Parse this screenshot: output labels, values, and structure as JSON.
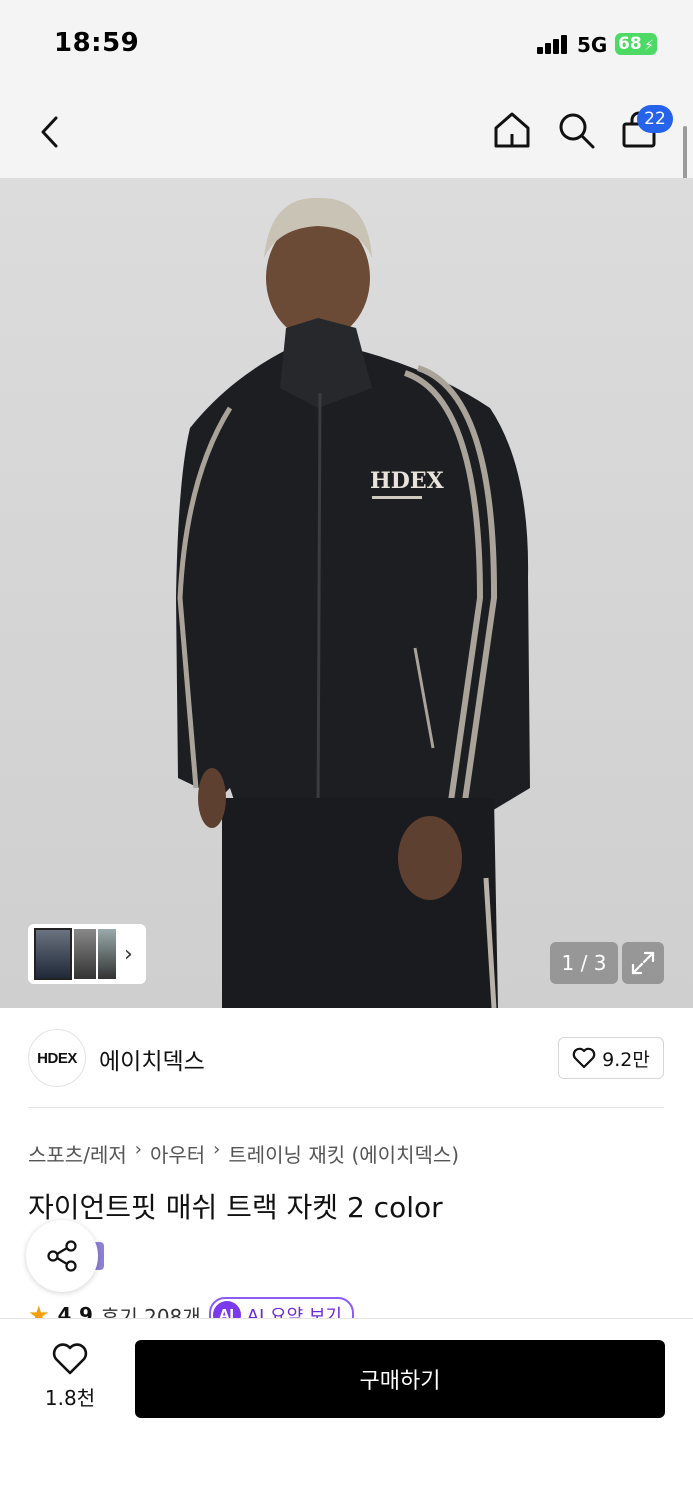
{
  "status": {
    "time": "18:59",
    "network": "5G",
    "battery": "68"
  },
  "nav": {
    "cart_count": "22"
  },
  "gallery": {
    "page_indicator": "1 / 3",
    "current_page": 1,
    "total_pages": 3
  },
  "brand": {
    "logo_text": "HDEX",
    "name": "에이치덱스",
    "likes": "9.2만"
  },
  "breadcrumb": [
    "스포츠/레저",
    "아우터",
    "트레이닝 재킷 (에이치덱스)"
  ],
  "product": {
    "title": "자이언트핏 매쉬 트랙 자켓 2 color",
    "rating": "4.9",
    "reviews": "후기 208개",
    "ai_badge": "AI",
    "ai_summary": "AI 요약 보기"
  },
  "bottom": {
    "wish_count": "1.8천",
    "buy_label": "구매하기"
  },
  "colors": {
    "cart_badge": "#2563eb",
    "battery": "#4cd964",
    "buy_button": "#000000",
    "ai_accent": "#7c3aed"
  }
}
